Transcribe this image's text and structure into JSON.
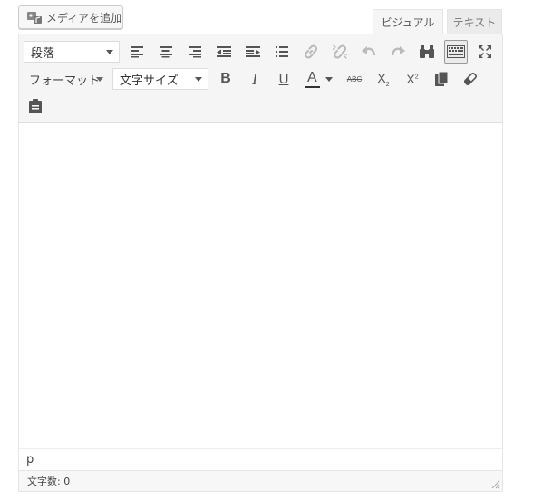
{
  "media_button": {
    "label": "メディアを追加",
    "icon": "add-media-icon"
  },
  "tabs": [
    {
      "label": "ビジュアル",
      "active": true
    },
    {
      "label": "テキスト",
      "active": false
    }
  ],
  "toolbar": {
    "paragraph_select": "段落",
    "format_menu": "フォーマット",
    "font_size_select": "文字サイズ",
    "bold": "B",
    "italic": "I",
    "underline": "U",
    "text_color": "A",
    "strike": "ABC",
    "subscript": "X",
    "subscript_mark": "2",
    "superscript": "X",
    "superscript_mark": "2"
  },
  "editor": {
    "element_path": "p",
    "word_count": "文字数: 0"
  },
  "colors": {
    "toolbar_bg": "#f5f5f5",
    "icon": "#555555",
    "icon_disabled": "#bbbbbb",
    "text_color_bar": "#333333"
  }
}
